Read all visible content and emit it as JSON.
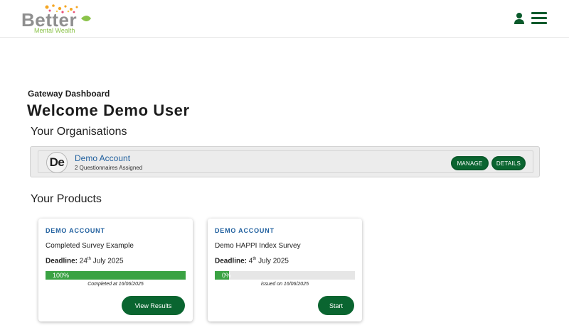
{
  "brand": {
    "name": "Better",
    "tagline": "Mental Wealth",
    "accent": "#0a6530",
    "link": "#1f5f9e",
    "progress": "#3aa243"
  },
  "header": {
    "user_icon": "person-icon",
    "menu_icon": "hamburger-menu-icon"
  },
  "page": {
    "subtitle": "Gateway Dashboard",
    "welcome": "Welcome Demo User"
  },
  "organisations": {
    "title": "Your Organisations",
    "items": [
      {
        "initials": "De",
        "name": "Demo Account",
        "sub": "2 Questionnaires Assigned",
        "manage_label": "MANAGE",
        "details_label": "DETAILS"
      }
    ]
  },
  "products": {
    "title": "Your Products",
    "cards": [
      {
        "org": "DEMO ACCOUNT",
        "title": "Completed Survey Example",
        "deadline_label": "Deadline:",
        "deadline_day": "24",
        "deadline_suffix": "th",
        "deadline_rest": " July 2025",
        "progress_text": "100%",
        "progress": 1.0,
        "status": "Completed at 16/06/2025",
        "button": "View Results"
      },
      {
        "org": "DEMO ACCOUNT",
        "title": "Demo HAPPI Index Survey",
        "deadline_label": "Deadline:",
        "deadline_day": "4",
        "deadline_suffix": "th",
        "deadline_rest": " July 2025",
        "progress_text": "0%",
        "progress": 0.0,
        "status": "issued on 16/06/2025",
        "button": "Start"
      }
    ]
  }
}
